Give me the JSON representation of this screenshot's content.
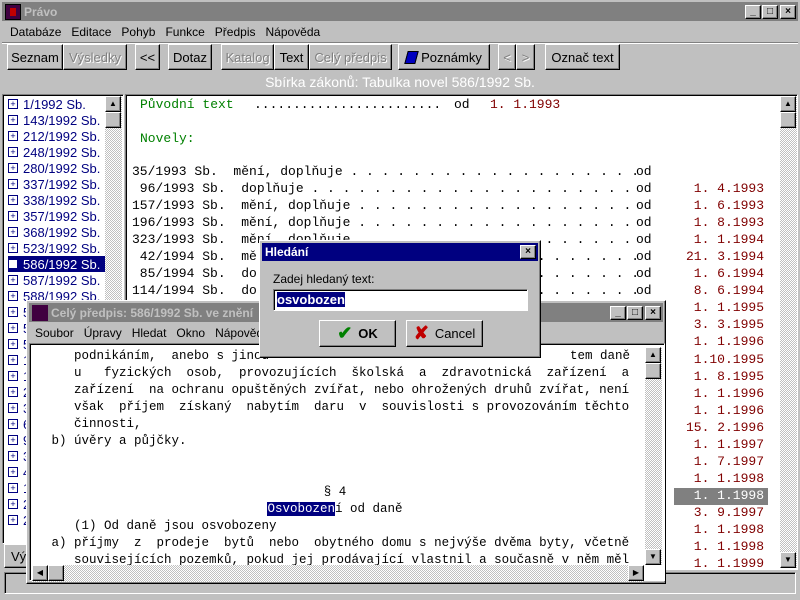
{
  "app": {
    "title": "Právo",
    "icon": "app-logo-icon"
  },
  "menu": [
    "Databáze",
    "Editace",
    "Pohyb",
    "Funkce",
    "Předpis",
    "Nápověda"
  ],
  "toolbar": {
    "seznam": "Seznam",
    "vysledky": "Výsledky",
    "back": "<<",
    "dotaz": "Dotaz",
    "katalog": "Katalog",
    "text": "Text",
    "cely": "Celý předpis",
    "poznamky": "Poznámky",
    "prev": "<",
    "next": ">",
    "oznac": "Označ text"
  },
  "header": "Sbírka zákonů:   Tabulka novel 586/1992 Sb.",
  "list": [
    "1/1992 Sb.",
    "143/1992 Sb.",
    "212/1992 Sb.",
    "248/1992 Sb.",
    "280/1992 Sb.",
    "337/1992 Sb.",
    "338/1992 Sb.",
    "357/1992 Sb.",
    "368/1992 Sb.",
    "523/1992 Sb.",
    "586/1992 Sb.",
    "587/1992 Sb.",
    "588/1992 Sb.",
    "5",
    "5",
    "5",
    "1",
    "1",
    "2",
    "3",
    "6",
    "9",
    "3",
    "4",
    "1",
    "2",
    "2"
  ],
  "list_selected": 10,
  "main": {
    "original_label": "Původní text",
    "original_dots": "........................",
    "original_od": "od",
    "original_date": "1. 1.1993",
    "novely_label": "Novely:",
    "rows": [
      {
        "code": "35/1993 Sb.",
        "verb": "  mění, doplňuje "
      },
      {
        "code": " 96/1993 Sb.",
        "verb": "  doplňuje "
      },
      {
        "code": "157/1993 Sb.",
        "verb": "  mění, doplňuje "
      },
      {
        "code": "196/1993 Sb.",
        "verb": "  mění, doplňuje "
      },
      {
        "code": "323/1993 Sb.",
        "verb": "  mění, doplňuje "
      },
      {
        "code": " 42/1994 Sb.",
        "verb": "  mě"
      },
      {
        "code": " 85/1994 Sb.",
        "verb": "  do"
      },
      {
        "code": "114/1994 Sb.",
        "verb": "  do"
      }
    ],
    "od": "od",
    "dates": [
      "1. 4.1993",
      "1. 6.1993",
      "1. 8.1993",
      "1. 1.1994",
      "21. 3.1994",
      "1. 6.1994",
      "8. 6.1994",
      "1. 1.1995",
      "3. 3.1995",
      "1. 1.1996",
      "1.10.1995",
      "1. 8.1995",
      "1. 1.1996",
      "1. 1.1996",
      "15. 2.1996",
      "1. 1.1997",
      "1. 7.1997",
      "1. 1.1998",
      "1. 1.1998",
      "3. 9.1997",
      "1. 1.1998",
      "1. 1.1998",
      "1. 1.1999"
    ],
    "selected_date": 18
  },
  "status_tab": "Vý",
  "child": {
    "title": "Celý předpis: 586/1992 Sb. ve znění",
    "menu": [
      "Soubor",
      "Úpravy",
      "Hledat",
      "Okno",
      "Nápověda"
    ],
    "lines": [
      "    podnikáním,  anebo s jinou",
      "    u   fyzických  osob,  provozujících  školská  a  zdravotnická  zařízení  a",
      "    zařízení  na ochranu opuštěných zvířat, nebo ohrožených druhů zvířat, není",
      "    však  příjem  získaný  nabytím  daru  v  souvislosti s provozováním těchto",
      "    činnosti,",
      " b) úvěry a půjčky."
    ],
    "line0_tail": "tem daně",
    "section": "§ 4",
    "heading_highlight": "Osvobozen",
    "heading_rest": "í od daně",
    "lines2": [
      "    (1) Od daně jsou osvobozeny",
      " a) příjmy  z  prodeje  bytů  nebo  obytného domu s nejvýše dvěma byty, včetně",
      "    souvisejících pozemků, pokud jej prodávající vlastnil a současně v něm měl"
    ]
  },
  "dialog": {
    "title": "Hledání",
    "label": "Zadej hledaný text:",
    "value": "osvobozen",
    "ok": "OK",
    "cancel": "Cancel"
  }
}
